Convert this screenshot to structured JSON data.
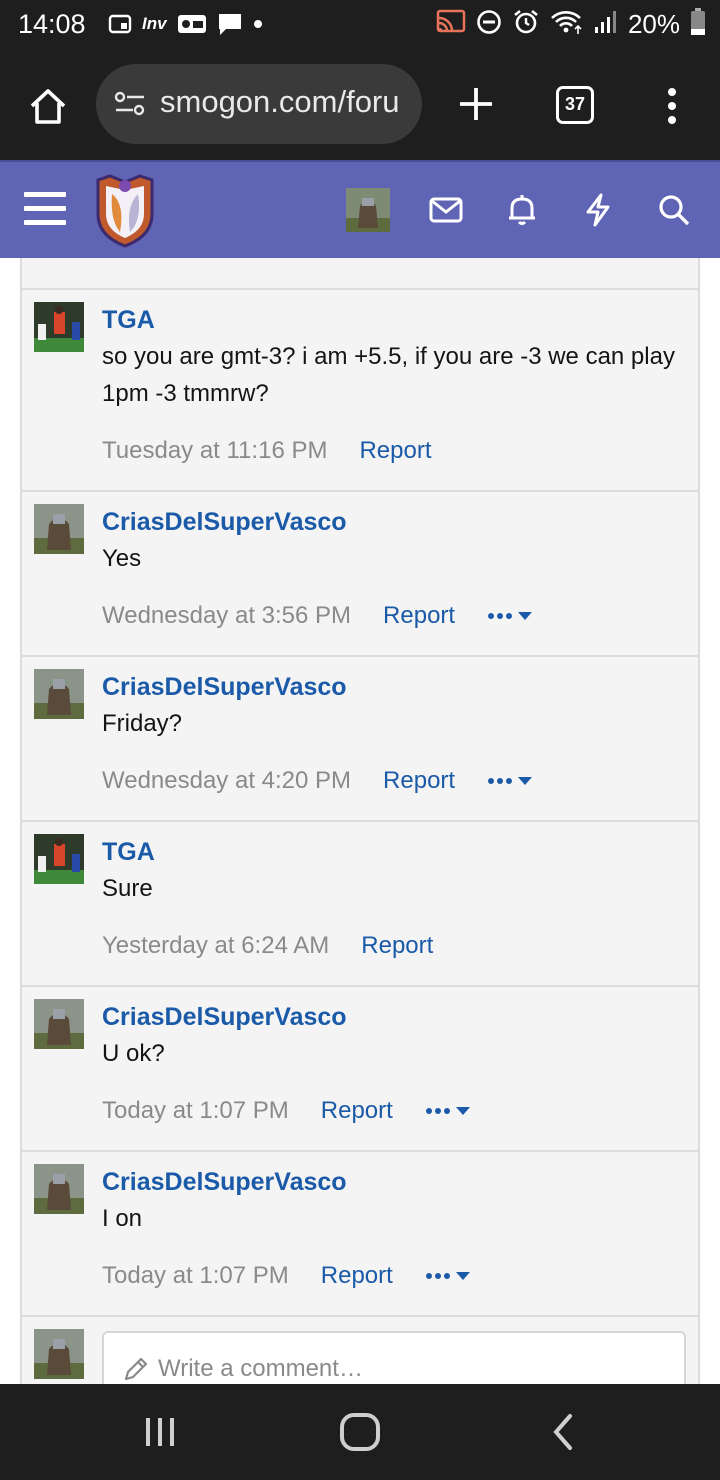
{
  "status_bar": {
    "time": "14:08",
    "left_icons": [
      "cast-screen-icon",
      "inv-app-icon",
      "game-app-icon",
      "message-icon",
      "dot-icon"
    ],
    "inv_label": "Inv",
    "battery_percent": "20%",
    "right_icons": [
      "cast-icon",
      "do-not-disturb-icon",
      "alarm-icon",
      "wifi-icon",
      "signal-icon",
      "battery-icon"
    ]
  },
  "browser": {
    "url": "smogon.com/foru",
    "tab_count": "37",
    "icons": [
      "home-icon",
      "site-settings-icon",
      "new-tab-icon",
      "tab-switcher-icon",
      "overflow-menu-icon"
    ]
  },
  "site_header": {
    "icons": [
      "hamburger-icon",
      "site-logo",
      "user-avatar",
      "inbox-icon",
      "alerts-bell-icon",
      "whats-new-bolt-icon",
      "search-icon"
    ],
    "colors": {
      "bar": "#6064b4"
    }
  },
  "comments": [
    {
      "author": "TGA",
      "avatar": "tga-avatar",
      "text": "so you are gmt-3? i am +5.5, if you are -3 we can play 1pm -3 tmmrw?",
      "time": "Tuesday at 11:16 PM",
      "report": "Report",
      "has_more": false
    },
    {
      "author": "CriasDelSuperVasco",
      "avatar": "crias-avatar",
      "text": "Yes",
      "time": "Wednesday at 3:56 PM",
      "report": "Report",
      "has_more": true
    },
    {
      "author": "CriasDelSuperVasco",
      "avatar": "crias-avatar",
      "text": "Friday?",
      "time": "Wednesday at 4:20 PM",
      "report": "Report",
      "has_more": true
    },
    {
      "author": "TGA",
      "avatar": "tga-avatar",
      "text": "Sure",
      "time": "Yesterday at 6:24 AM",
      "report": "Report",
      "has_more": false
    },
    {
      "author": "CriasDelSuperVasco",
      "avatar": "crias-avatar",
      "text": "U ok?",
      "time": "Today at 1:07 PM",
      "report": "Report",
      "has_more": true
    },
    {
      "author": "CriasDelSuperVasco",
      "avatar": "crias-avatar",
      "text": "I on",
      "time": "Today at 1:07 PM",
      "report": "Report",
      "has_more": true
    }
  ],
  "write_comment": {
    "placeholder": "Write a comment…"
  },
  "nav_bar": {
    "icons": [
      "recents-icon",
      "home-circle-icon",
      "back-icon"
    ]
  },
  "colors": {
    "link": "#1a5aa8",
    "meta": "#8a8a8a",
    "card_bg": "#f4f4f4"
  }
}
